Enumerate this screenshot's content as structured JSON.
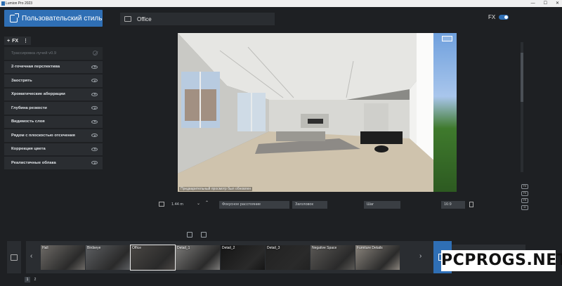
{
  "window": {
    "title": "Lumion Pro 2023"
  },
  "style_button": {
    "label": "Пользовательский стиль"
  },
  "fx_panel": {
    "add_label": "FX",
    "effects": [
      {
        "label": "Трассировка лучей v0.9",
        "enabled": false
      },
      {
        "label": "2-точечная перспектива",
        "enabled": true
      },
      {
        "label": "Заострять",
        "enabled": true
      },
      {
        "label": "Хроматические аберрации",
        "enabled": true
      },
      {
        "label": "Глубина резкости",
        "enabled": true
      },
      {
        "label": "Видимость слоя",
        "enabled": true
      },
      {
        "label": "Рядом с плоскостью отсечения",
        "enabled": true
      },
      {
        "label": "Коррекция цвета",
        "enabled": true
      },
      {
        "label": "Реалистичные облака",
        "enabled": true
      }
    ]
  },
  "camera": {
    "name": "Office"
  },
  "fx_toggle": {
    "label": "FX",
    "on": true
  },
  "viewport": {
    "preview_note": "Предварительный просмотр был обновлен"
  },
  "side_chips": [
    "FH",
    "FS",
    "FR",
    "M"
  ],
  "toolbar": {
    "height_value": "1.44 m",
    "focal_label": "Фокусное расстояние",
    "title_label": "Заголовок",
    "step_label": "Шаг",
    "aspect": "16:9"
  },
  "gallery": {
    "thumbnails": [
      {
        "label": "Hall",
        "selected": false,
        "color": "#6d6a66"
      },
      {
        "label": "Birdseye",
        "selected": false,
        "color": "#5d5f62"
      },
      {
        "label": "Office",
        "selected": true,
        "color": "#4a4744"
      },
      {
        "label": "Detail_1",
        "selected": false,
        "color": "#7b7a78"
      },
      {
        "label": "Detail_2",
        "selected": false,
        "color": "#151515"
      },
      {
        "label": "Detail_3",
        "selected": false,
        "color": "#222222"
      },
      {
        "label": "Negative Space",
        "selected": false,
        "color": "#5a5855"
      },
      {
        "label": "Furniture Details",
        "selected": false,
        "color": "#8b857d"
      }
    ]
  },
  "pager": {
    "pages": [
      "1",
      "2"
    ],
    "active": "1"
  },
  "watermark": {
    "text": "PCPROGS.NET"
  }
}
